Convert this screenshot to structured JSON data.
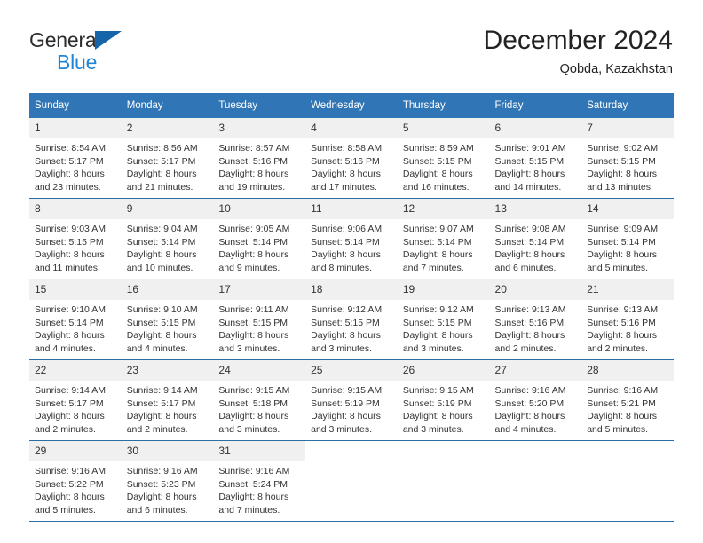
{
  "brand": {
    "name_part1": "General",
    "name_part2": "Blue",
    "triangle_color": "#1565a8",
    "blue_color": "#1e86d8"
  },
  "header": {
    "title": "December 2024",
    "subtitle": "Qobda, Kazakhstan"
  },
  "theme": {
    "header_bg": "#3075b5",
    "row_divider": "#2e6da4",
    "daynum_bg": "#f0f0f0",
    "text": "#333333"
  },
  "weekdays": [
    "Sunday",
    "Monday",
    "Tuesday",
    "Wednesday",
    "Thursday",
    "Friday",
    "Saturday"
  ],
  "labels": {
    "sunrise": "Sunrise:",
    "sunset": "Sunset:",
    "daylight": "Daylight:"
  },
  "weeks": [
    [
      {
        "day": "1",
        "sunrise": "Sunrise: 8:54 AM",
        "sunset": "Sunset: 5:17 PM",
        "daylight1": "Daylight: 8 hours",
        "daylight2": "and 23 minutes."
      },
      {
        "day": "2",
        "sunrise": "Sunrise: 8:56 AM",
        "sunset": "Sunset: 5:17 PM",
        "daylight1": "Daylight: 8 hours",
        "daylight2": "and 21 minutes."
      },
      {
        "day": "3",
        "sunrise": "Sunrise: 8:57 AM",
        "sunset": "Sunset: 5:16 PM",
        "daylight1": "Daylight: 8 hours",
        "daylight2": "and 19 minutes."
      },
      {
        "day": "4",
        "sunrise": "Sunrise: 8:58 AM",
        "sunset": "Sunset: 5:16 PM",
        "daylight1": "Daylight: 8 hours",
        "daylight2": "and 17 minutes."
      },
      {
        "day": "5",
        "sunrise": "Sunrise: 8:59 AM",
        "sunset": "Sunset: 5:15 PM",
        "daylight1": "Daylight: 8 hours",
        "daylight2": "and 16 minutes."
      },
      {
        "day": "6",
        "sunrise": "Sunrise: 9:01 AM",
        "sunset": "Sunset: 5:15 PM",
        "daylight1": "Daylight: 8 hours",
        "daylight2": "and 14 minutes."
      },
      {
        "day": "7",
        "sunrise": "Sunrise: 9:02 AM",
        "sunset": "Sunset: 5:15 PM",
        "daylight1": "Daylight: 8 hours",
        "daylight2": "and 13 minutes."
      }
    ],
    [
      {
        "day": "8",
        "sunrise": "Sunrise: 9:03 AM",
        "sunset": "Sunset: 5:15 PM",
        "daylight1": "Daylight: 8 hours",
        "daylight2": "and 11 minutes."
      },
      {
        "day": "9",
        "sunrise": "Sunrise: 9:04 AM",
        "sunset": "Sunset: 5:14 PM",
        "daylight1": "Daylight: 8 hours",
        "daylight2": "and 10 minutes."
      },
      {
        "day": "10",
        "sunrise": "Sunrise: 9:05 AM",
        "sunset": "Sunset: 5:14 PM",
        "daylight1": "Daylight: 8 hours",
        "daylight2": "and 9 minutes."
      },
      {
        "day": "11",
        "sunrise": "Sunrise: 9:06 AM",
        "sunset": "Sunset: 5:14 PM",
        "daylight1": "Daylight: 8 hours",
        "daylight2": "and 8 minutes."
      },
      {
        "day": "12",
        "sunrise": "Sunrise: 9:07 AM",
        "sunset": "Sunset: 5:14 PM",
        "daylight1": "Daylight: 8 hours",
        "daylight2": "and 7 minutes."
      },
      {
        "day": "13",
        "sunrise": "Sunrise: 9:08 AM",
        "sunset": "Sunset: 5:14 PM",
        "daylight1": "Daylight: 8 hours",
        "daylight2": "and 6 minutes."
      },
      {
        "day": "14",
        "sunrise": "Sunrise: 9:09 AM",
        "sunset": "Sunset: 5:14 PM",
        "daylight1": "Daylight: 8 hours",
        "daylight2": "and 5 minutes."
      }
    ],
    [
      {
        "day": "15",
        "sunrise": "Sunrise: 9:10 AM",
        "sunset": "Sunset: 5:14 PM",
        "daylight1": "Daylight: 8 hours",
        "daylight2": "and 4 minutes."
      },
      {
        "day": "16",
        "sunrise": "Sunrise: 9:10 AM",
        "sunset": "Sunset: 5:15 PM",
        "daylight1": "Daylight: 8 hours",
        "daylight2": "and 4 minutes."
      },
      {
        "day": "17",
        "sunrise": "Sunrise: 9:11 AM",
        "sunset": "Sunset: 5:15 PM",
        "daylight1": "Daylight: 8 hours",
        "daylight2": "and 3 minutes."
      },
      {
        "day": "18",
        "sunrise": "Sunrise: 9:12 AM",
        "sunset": "Sunset: 5:15 PM",
        "daylight1": "Daylight: 8 hours",
        "daylight2": "and 3 minutes."
      },
      {
        "day": "19",
        "sunrise": "Sunrise: 9:12 AM",
        "sunset": "Sunset: 5:15 PM",
        "daylight1": "Daylight: 8 hours",
        "daylight2": "and 3 minutes."
      },
      {
        "day": "20",
        "sunrise": "Sunrise: 9:13 AM",
        "sunset": "Sunset: 5:16 PM",
        "daylight1": "Daylight: 8 hours",
        "daylight2": "and 2 minutes."
      },
      {
        "day": "21",
        "sunrise": "Sunrise: 9:13 AM",
        "sunset": "Sunset: 5:16 PM",
        "daylight1": "Daylight: 8 hours",
        "daylight2": "and 2 minutes."
      }
    ],
    [
      {
        "day": "22",
        "sunrise": "Sunrise: 9:14 AM",
        "sunset": "Sunset: 5:17 PM",
        "daylight1": "Daylight: 8 hours",
        "daylight2": "and 2 minutes."
      },
      {
        "day": "23",
        "sunrise": "Sunrise: 9:14 AM",
        "sunset": "Sunset: 5:17 PM",
        "daylight1": "Daylight: 8 hours",
        "daylight2": "and 2 minutes."
      },
      {
        "day": "24",
        "sunrise": "Sunrise: 9:15 AM",
        "sunset": "Sunset: 5:18 PM",
        "daylight1": "Daylight: 8 hours",
        "daylight2": "and 3 minutes."
      },
      {
        "day": "25",
        "sunrise": "Sunrise: 9:15 AM",
        "sunset": "Sunset: 5:19 PM",
        "daylight1": "Daylight: 8 hours",
        "daylight2": "and 3 minutes."
      },
      {
        "day": "26",
        "sunrise": "Sunrise: 9:15 AM",
        "sunset": "Sunset: 5:19 PM",
        "daylight1": "Daylight: 8 hours",
        "daylight2": "and 3 minutes."
      },
      {
        "day": "27",
        "sunrise": "Sunrise: 9:16 AM",
        "sunset": "Sunset: 5:20 PM",
        "daylight1": "Daylight: 8 hours",
        "daylight2": "and 4 minutes."
      },
      {
        "day": "28",
        "sunrise": "Sunrise: 9:16 AM",
        "sunset": "Sunset: 5:21 PM",
        "daylight1": "Daylight: 8 hours",
        "daylight2": "and 5 minutes."
      }
    ],
    [
      {
        "day": "29",
        "sunrise": "Sunrise: 9:16 AM",
        "sunset": "Sunset: 5:22 PM",
        "daylight1": "Daylight: 8 hours",
        "daylight2": "and 5 minutes."
      },
      {
        "day": "30",
        "sunrise": "Sunrise: 9:16 AM",
        "sunset": "Sunset: 5:23 PM",
        "daylight1": "Daylight: 8 hours",
        "daylight2": "and 6 minutes."
      },
      {
        "day": "31",
        "sunrise": "Sunrise: 9:16 AM",
        "sunset": "Sunset: 5:24 PM",
        "daylight1": "Daylight: 8 hours",
        "daylight2": "and 7 minutes."
      },
      {
        "day": "",
        "sunrise": "",
        "sunset": "",
        "daylight1": "",
        "daylight2": ""
      },
      {
        "day": "",
        "sunrise": "",
        "sunset": "",
        "daylight1": "",
        "daylight2": ""
      },
      {
        "day": "",
        "sunrise": "",
        "sunset": "",
        "daylight1": "",
        "daylight2": ""
      },
      {
        "day": "",
        "sunrise": "",
        "sunset": "",
        "daylight1": "",
        "daylight2": ""
      }
    ]
  ]
}
